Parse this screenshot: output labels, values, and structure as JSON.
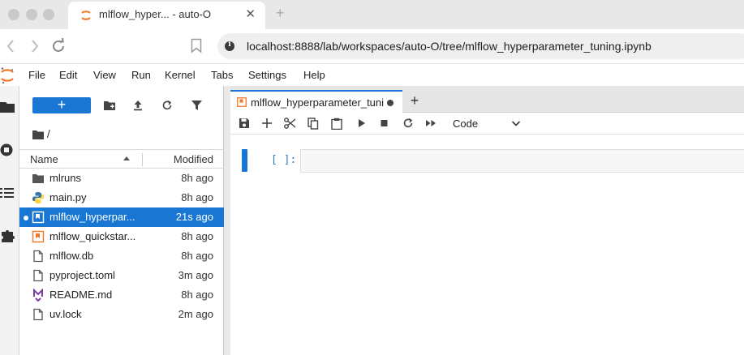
{
  "browser": {
    "tab_title": "mlflow_hyper... - auto-O",
    "new_tab": "+",
    "url": "localhost:8888/lab/workspaces/auto-O/tree/mlflow_hyperparameter_tuning.ipynb"
  },
  "menu": [
    "File",
    "Edit",
    "View",
    "Run",
    "Kernel",
    "Tabs",
    "Settings",
    "Help"
  ],
  "filebrowser": {
    "new_button": "+",
    "path": "/",
    "col_name": "Name",
    "col_modified": "Modified",
    "files": [
      {
        "name": "mlruns",
        "modified": "8h ago",
        "icon": "folder-icon"
      },
      {
        "name": "main.py",
        "modified": "8h ago",
        "icon": "python-icon"
      },
      {
        "name": "mlflow_hyperpar...",
        "modified": "21s ago",
        "icon": "notebook-icon",
        "selected": true,
        "running": true
      },
      {
        "name": "mlflow_quickstar...",
        "modified": "8h ago",
        "icon": "notebook-icon"
      },
      {
        "name": "mlflow.db",
        "modified": "8h ago",
        "icon": "file-icon"
      },
      {
        "name": "pyproject.toml",
        "modified": "3m ago",
        "icon": "file-icon"
      },
      {
        "name": "README.md",
        "modified": "8h ago",
        "icon": "markdown-icon"
      },
      {
        "name": "uv.lock",
        "modified": "2m ago",
        "icon": "file-icon"
      }
    ]
  },
  "notebook": {
    "tab_label": "mlflow_hyperparameter_tuning.ipynb",
    "add_tab": "+",
    "cell_type": "Code",
    "prompt": "[ ]:"
  },
  "colors": {
    "accent": "#1976d2",
    "notebook_orange": "#f37726"
  }
}
